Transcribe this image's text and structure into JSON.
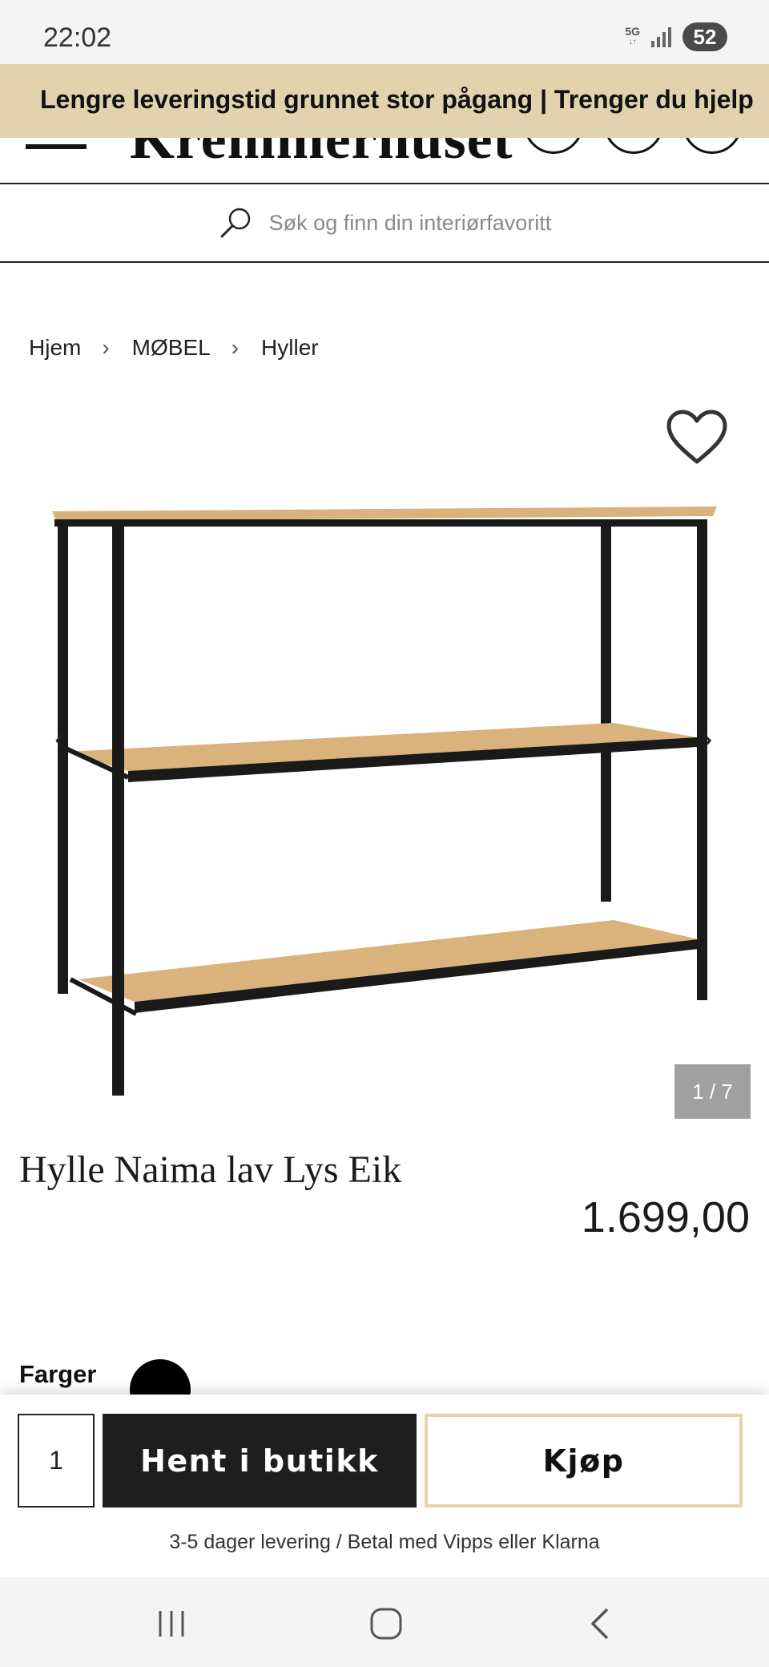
{
  "status_bar": {
    "time": "22:02",
    "network": "5G",
    "battery": "52"
  },
  "promo": {
    "text": "Lengre leveringstid grunnet stor pågang | Trenger du hjelp"
  },
  "header": {
    "logo": "Kremmerhuset"
  },
  "search": {
    "placeholder": "Søk og finn din interiørfavoritt"
  },
  "breadcrumb": {
    "items": [
      "Hjem",
      "MØBEL",
      "Hyller"
    ],
    "separator": "›"
  },
  "gallery": {
    "prev": "‹",
    "next": "›",
    "counter": "1 / 7"
  },
  "product": {
    "title": "Hylle Naima lav Lys Eik",
    "price": "1.699,00"
  },
  "options": {
    "colors_label": "Farger",
    "selected_color": "#000000"
  },
  "buy_bar": {
    "quantity": "1",
    "pickup_label": "Hent i butikk",
    "buy_label": "Kjøp",
    "delivery_text": "3-5 dager levering / Betal med Vipps eller Klarna"
  },
  "colors": {
    "banner": "#e2d3ae",
    "dark": "#1e1e1e",
    "wood": "#d9b27c"
  }
}
